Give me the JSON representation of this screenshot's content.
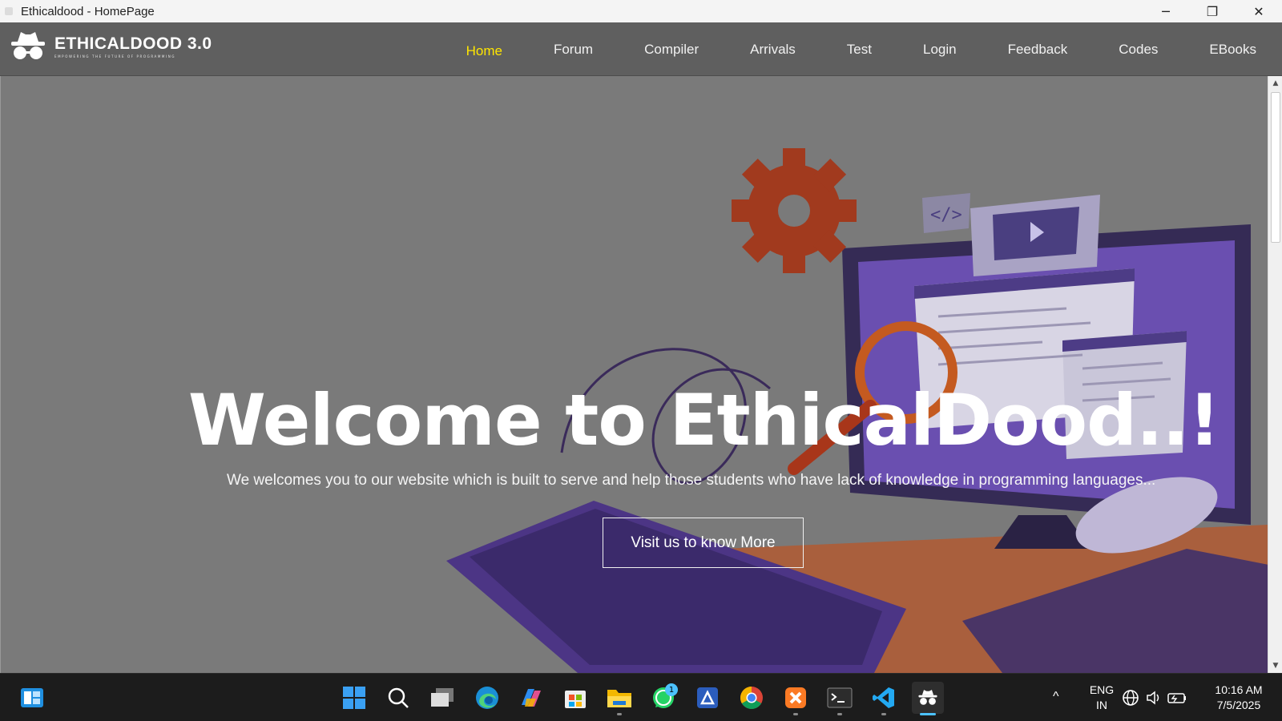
{
  "window": {
    "title": "Ethicaldood - HomePage",
    "minimize_glyph": "─",
    "restore_glyph": "❐",
    "close_glyph": "✕"
  },
  "brand": {
    "name": "ETHICALDOOD 3.0",
    "tagline": "EMPOWERING THE FUTURE OF PROGRAMMING"
  },
  "nav": {
    "items": [
      {
        "label": "Home",
        "active": true
      },
      {
        "label": "Forum"
      },
      {
        "label": "Compiler"
      },
      {
        "label": "Arrivals"
      },
      {
        "label": "Test"
      },
      {
        "label": "Login"
      },
      {
        "label": "Feedback"
      },
      {
        "label": "Codes"
      },
      {
        "label": "EBooks"
      }
    ]
  },
  "hero": {
    "title": "Welcome to EthicalDood..!",
    "subtitle": "We welcomes you to our website which is built to serve and help those students who have lack of knowledge in programming languages...",
    "button": "Visit us to know More"
  },
  "scrollbar": {
    "up": "▲",
    "down": "▼"
  },
  "taskbar": {
    "icons": [
      "widgets-icon",
      "start-icon",
      "search-icon",
      "task-view-icon",
      "edge-icon",
      "copilot-icon",
      "store-icon",
      "file-explorer-icon",
      "whatsapp-icon",
      "app-icon",
      "chrome-icon",
      "xampp-icon",
      "terminal-icon",
      "vscode-icon",
      "ethicaldood-icon"
    ],
    "whatsapp_badge": "1",
    "tray": {
      "chevron": "^",
      "lang_line1": "ENG",
      "lang_line2": "IN",
      "time": "10:16 AM",
      "date": "7/5/2025"
    }
  },
  "colors": {
    "nav_bg": "#5f5f5f",
    "nav_active": "#ffe600",
    "hero_overlay": "#7a7a7a",
    "taskbar_bg": "#1c1c1c",
    "accent": "#4cc2ff"
  }
}
